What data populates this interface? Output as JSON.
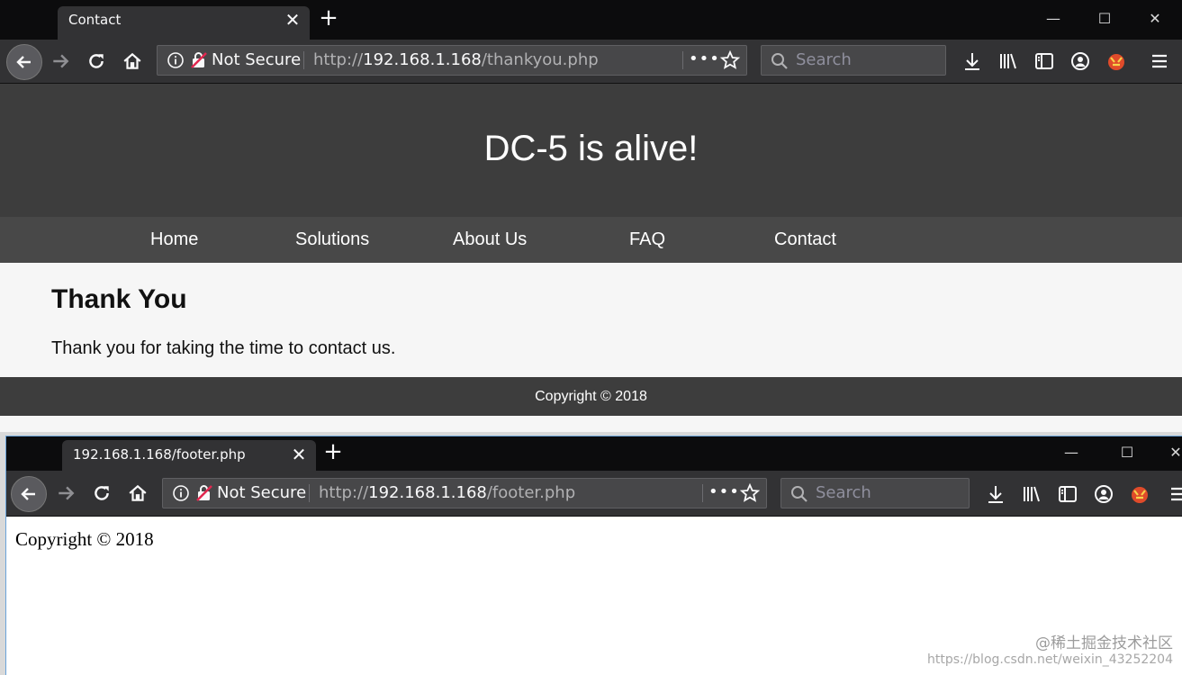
{
  "window1": {
    "tab_title": "Contact",
    "tab_close": "✕",
    "new_tab": "+",
    "window_controls": {
      "minimize": "—",
      "maximize": "☐",
      "close": "✕"
    },
    "nav": {
      "back_icon": "arrow-left-icon",
      "forward_icon": "arrow-right-icon",
      "reload_icon": "reload-icon",
      "home_icon": "home-icon"
    },
    "urlbar": {
      "security_label": "Not Secure",
      "url_prefix": "http://",
      "url_host": "192.168.1.168",
      "url_path": "/thankyou.php",
      "more": "•••"
    },
    "search": {
      "placeholder": "Search"
    },
    "site": {
      "title": "DC-5 is alive!",
      "nav_items": [
        "Home",
        "Solutions",
        "About Us",
        "FAQ",
        "Contact"
      ],
      "heading": "Thank You",
      "body": "Thank you for taking the time to contact us.",
      "footer": "Copyright © 2018"
    }
  },
  "window2": {
    "tab_title": "192.168.1.168/footer.php",
    "tab_close": "✕",
    "new_tab": "+",
    "window_controls": {
      "minimize": "—",
      "maximize": "☐",
      "close": "✕"
    },
    "urlbar": {
      "security_label": "Not Secure",
      "url_prefix": "http://",
      "url_host": "192.168.1.168",
      "url_path": "/footer.php",
      "more": "•••"
    },
    "search": {
      "placeholder": "Search"
    },
    "page_text": "Copyright © 2018"
  },
  "watermark": {
    "line1": "@稀土掘金技术社区",
    "line2": "https://blog.csdn.net/weixin_43252204"
  },
  "colors": {
    "tabbar": "#0c0c0d",
    "toolbar": "#323234",
    "header": "#3d3d3d",
    "nav": "#484848",
    "content": "#f6f6f6"
  }
}
